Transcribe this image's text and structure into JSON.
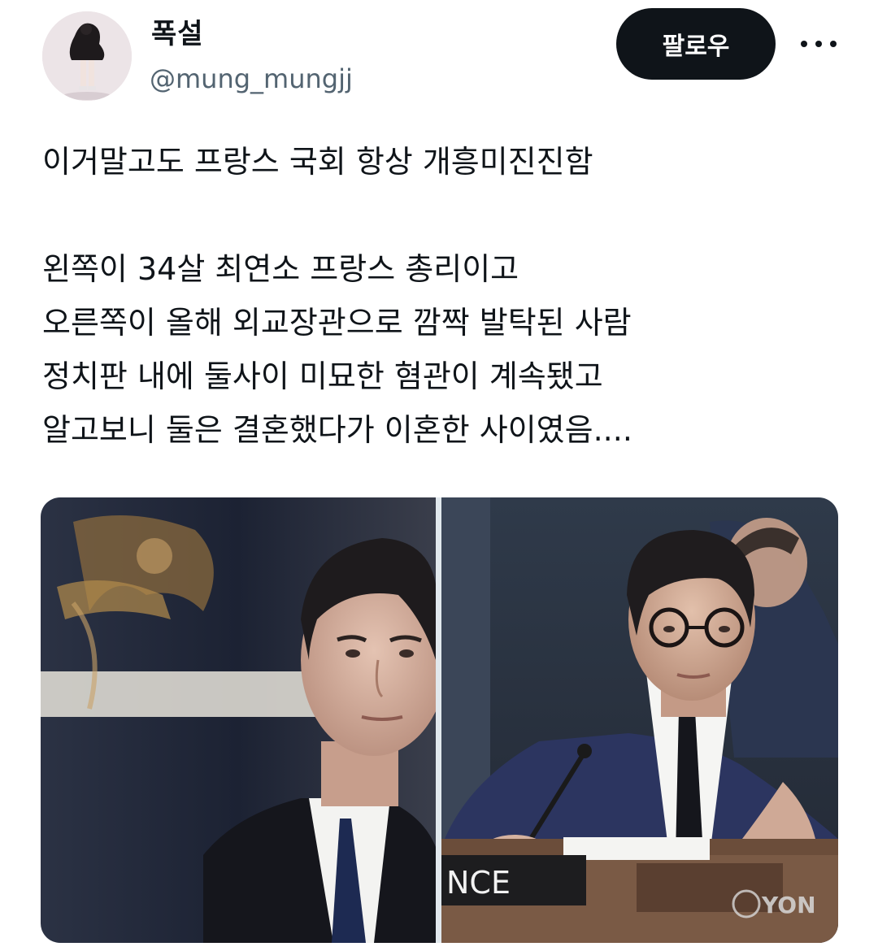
{
  "author": {
    "display_name": "폭설",
    "handle": "@mung_mungjj"
  },
  "actions": {
    "follow_label": "팔로우",
    "more_icon": "more-horizontal-icon"
  },
  "tweet": {
    "lines": [
      "이거말고도 프랑스 국회 항상 개흥미진진함",
      "",
      "왼쪽이 34살 최연소 프랑스 총리이고",
      "오른쪽이 올해 외교장관으로 깜짝 발탁된 사람",
      "정치판 내에 둘사이 미묘한 혐관이 계속됐고",
      "알고보니 둘은 결혼했다가 이혼한 사이였음...."
    ]
  },
  "media": {
    "right_photo": {
      "nameplate_text": "NCE",
      "watermark_text": "YON"
    }
  },
  "colors": {
    "text": "#0f1419",
    "secondary_text": "#536471",
    "follow_button_bg": "#0f1419",
    "follow_button_text": "#ffffff"
  }
}
